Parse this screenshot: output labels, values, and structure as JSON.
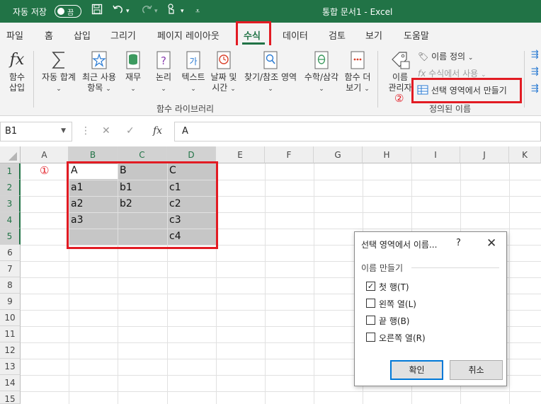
{
  "titlebar": {
    "autosave_label": "자동 저장",
    "autosave_state": "끔",
    "doc_title": "통합 문서1  -  Excel",
    "bg_color": "#217346"
  },
  "tabs": [
    "파일",
    "홈",
    "삽입",
    "그리기",
    "페이지 레이아웃",
    "수식",
    "데이터",
    "검토",
    "보기",
    "도움말"
  ],
  "active_tab": "수식",
  "ribbon": {
    "insert_function": {
      "line1": "함수",
      "line2": "삽입",
      "icon": "fx-icon"
    },
    "autosum": {
      "line1": "자동 합계",
      "icon": "sigma-icon"
    },
    "recent": {
      "line1": "최근 사용",
      "line2": "항목",
      "icon": "star-icon"
    },
    "financial": {
      "line1": "재무",
      "icon": "database-icon"
    },
    "logical": {
      "line1": "논리",
      "icon": "question-icon"
    },
    "text": {
      "line1": "텍스트",
      "icon": "text-ga-icon"
    },
    "datetime": {
      "line1": "날짜 및",
      "line2": "시간",
      "icon": "clock-icon"
    },
    "lookup": {
      "line1": "찾기/참조 영역",
      "icon": "magnifier-icon"
    },
    "math": {
      "line1": "수학/삼각",
      "icon": "theta-icon"
    },
    "more": {
      "line1": "함수 더",
      "line2": "보기",
      "icon": "more-icon"
    },
    "library_group": "함수 라이브러리",
    "name_manager": {
      "line1": "이름",
      "line2": "관리자",
      "icon": "name-tag-icon"
    },
    "define_name": "이름 정의",
    "use_in_formula": "수식에서 사용",
    "create_from_selection": "선택 영역에서 만들기",
    "defined_names_group": "정의된 이름",
    "marker_1": "①",
    "marker_2": "②"
  },
  "formula_bar": {
    "name_box": "B1",
    "formula": "A",
    "fx": "fx"
  },
  "grid": {
    "columns": [
      "A",
      "B",
      "C",
      "D",
      "E",
      "F",
      "G",
      "H",
      "I",
      "J",
      "K"
    ],
    "rows": [
      "1",
      "2",
      "3",
      "4",
      "5",
      "6",
      "7",
      "8",
      "9",
      "10",
      "11",
      "12",
      "13",
      "14",
      "15"
    ],
    "cells": {
      "B1": "A",
      "C1": "B",
      "D1": "C",
      "B2": "a1",
      "C2": "b1",
      "D2": "c1",
      "B3": "a2",
      "C3": "b2",
      "D3": "c2",
      "B4": "a3",
      "D4": "c3",
      "D5": "c4"
    }
  },
  "dialog": {
    "title": "선택 영역에서 이름...",
    "help": "?",
    "close": "✕",
    "group": "이름 만들기",
    "options": [
      {
        "label": "첫 행(T)",
        "checked": true
      },
      {
        "label": "왼쪽 열(L)",
        "checked": false
      },
      {
        "label": "끝 행(B)",
        "checked": false
      },
      {
        "label": "오른쪽 열(R)",
        "checked": false
      }
    ],
    "ok": "확인",
    "cancel": "취소"
  },
  "highlight_color": "#e21b23"
}
